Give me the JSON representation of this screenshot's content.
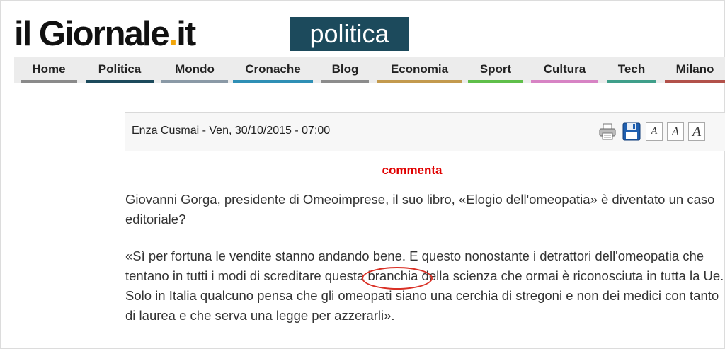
{
  "header": {
    "logo_main": "il Giornale",
    "logo_dot": ".",
    "logo_tld": "it",
    "section": "politica"
  },
  "nav": {
    "items": [
      {
        "label": "Home",
        "color": "#8a8a8a"
      },
      {
        "label": "Politica",
        "color": "#1c4a5c"
      },
      {
        "label": "Mondo",
        "color": "#8a99a6"
      },
      {
        "label": "Cronache",
        "color": "#2f8fb5"
      },
      {
        "label": "Blog",
        "color": "#8c8c8c"
      },
      {
        "label": "Economia",
        "color": "#c39a4e"
      },
      {
        "label": "Sport",
        "color": "#5fbf4a"
      },
      {
        "label": "Cultura",
        "color": "#d783c4"
      },
      {
        "label": "Tech",
        "color": "#3f9f8a"
      },
      {
        "label": "Milano",
        "color": "#b2514a"
      }
    ]
  },
  "article": {
    "author": "Enza Cusmai",
    "date": "Ven, 30/10/2015 - 07:00",
    "tools": [
      "print-icon",
      "save-icon",
      "font-small-icon",
      "font-medium-icon",
      "font-large-icon"
    ],
    "font_buttons": [
      "A",
      "A",
      "A"
    ],
    "comment_label": "commenta",
    "question": "Giovanni Gorga, presidente di Omeoimprese, il suo libro, «Elogio dell'omeopatia» è diventato un caso editoriale?",
    "answer_part1": "«Sì per fortuna le vendite stanno andando bene. E questo nonostante i detrattori dell'omeopatia che tentano in tutti i modi di screditare questa ",
    "answer_highlight": "branchia",
    "answer_part2": " della scienza che ormai è riconosciuta in tutta la Ue. Solo in Italia qualcuno pensa che gli omeopati siano una cerchia di stregoni e non dei medici con tanto di laurea e che serva una legge per azzerarli».",
    "highlight_color": "#d93025",
    "comment_color": "#e00000"
  }
}
